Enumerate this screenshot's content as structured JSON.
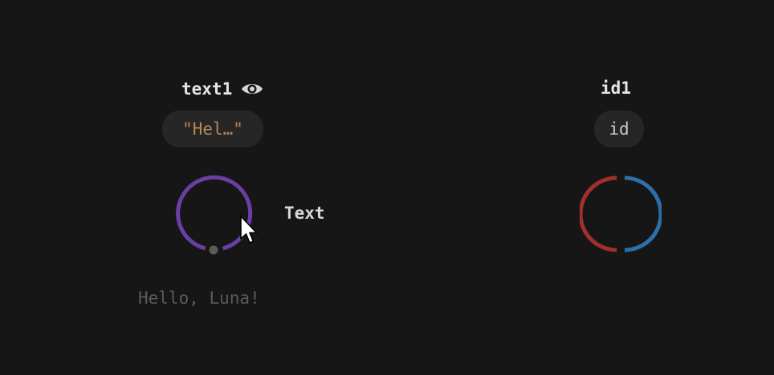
{
  "nodes": [
    {
      "title": "text1",
      "pill_value": "\"Hel…\"",
      "port_label": "Text",
      "output": "Hello, Luna!",
      "icon": "eye-icon"
    },
    {
      "title": "id1",
      "pill_value": "id"
    }
  ],
  "colors": {
    "background": "#161616",
    "text_ring": "#6a3fa5",
    "id_ring_left": "#a12f2a",
    "id_ring_right": "#2d6fa8",
    "pill_bg": "#262626",
    "string_value": "#b8865a"
  }
}
